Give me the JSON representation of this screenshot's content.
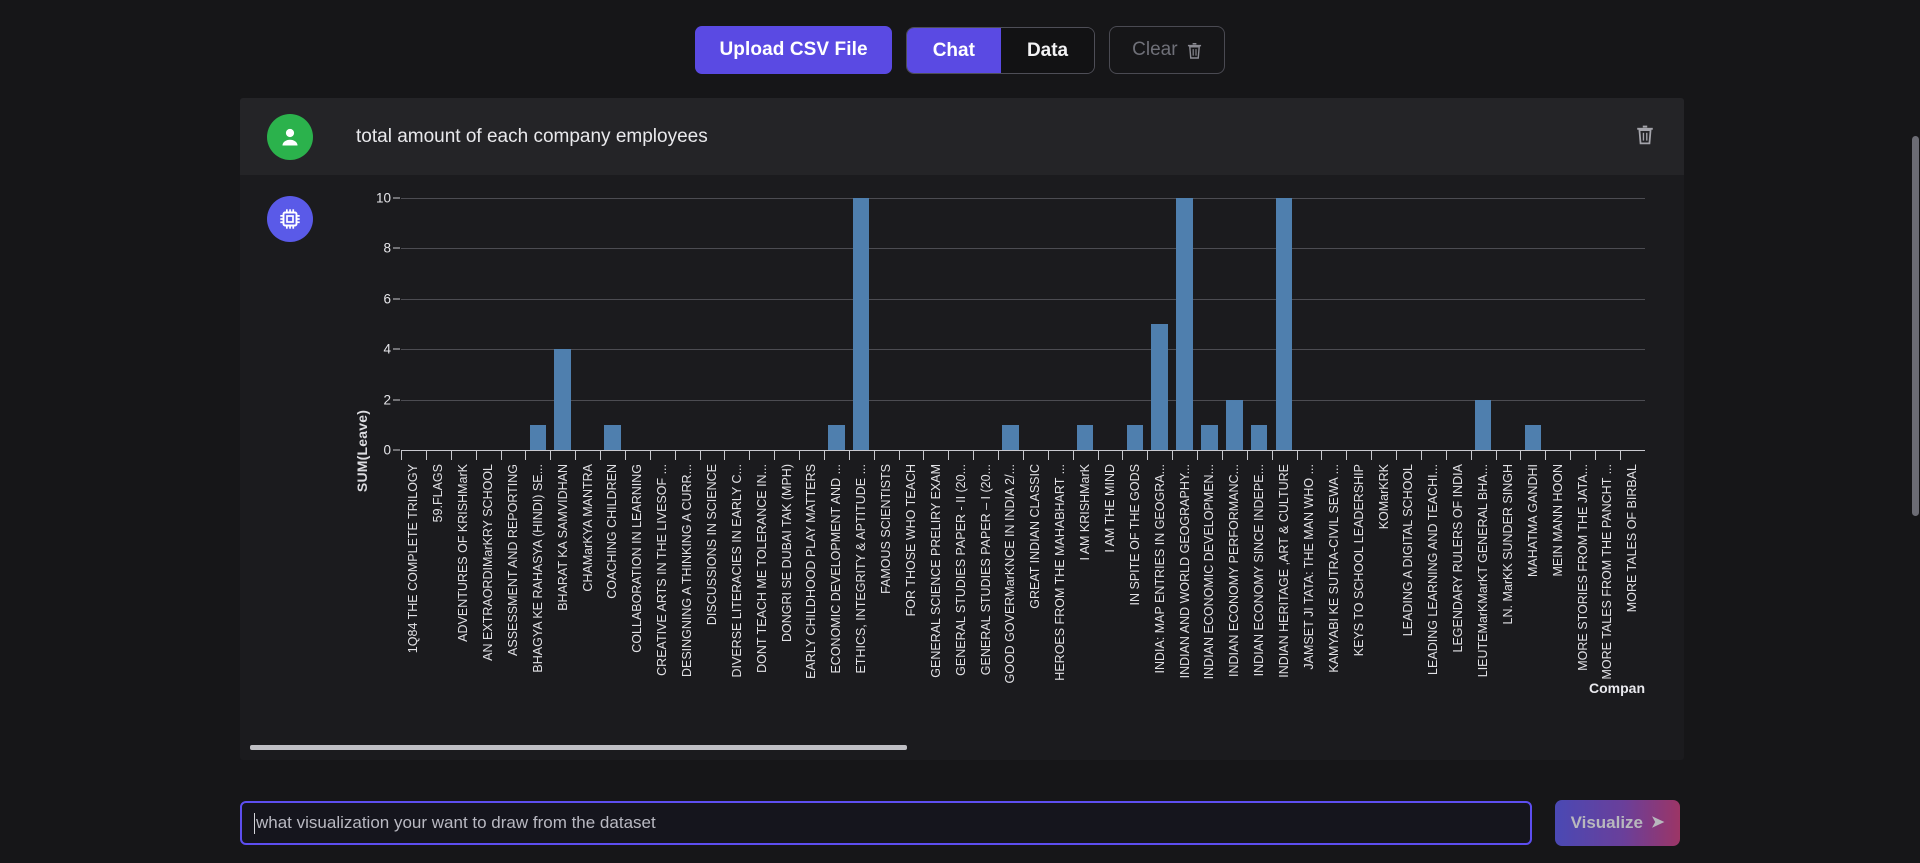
{
  "toolbar": {
    "upload_label": "Upload CSV File",
    "chat_label": "Chat",
    "data_label": "Data",
    "clear_label": "Clear",
    "trash_icon": "trash-icon",
    "accent": "#5a4ae3"
  },
  "conversation": {
    "user_message": "total amount of each company employees",
    "user_avatar_icon": "person-icon",
    "bot_avatar_icon": "cpu-chip-icon",
    "delete_icon": "trash-icon"
  },
  "input": {
    "placeholder": "what visualization your want to draw from the dataset",
    "value": "",
    "submit_label": "Visualize",
    "submit_icon": "send-arrow-icon"
  },
  "chart_data": {
    "type": "bar",
    "title": "",
    "xlabel": "Company",
    "ylabel": "SUM(Leave)",
    "ylim": [
      0,
      10
    ],
    "yticks": [
      0,
      2,
      4,
      6,
      8,
      10
    ],
    "grid": true,
    "bar_color": "#4f7fae",
    "legend": "none",
    "categories": [
      "1Q84 THE COMPLETE TRILOGY",
      "59.FLAGS",
      "ADVENTURES OF KRISHMarK",
      "AN EXTRAORDIMarKRY SCHOOL",
      "ASSESSMENT AND REPORTING",
      "BHAGYA KE RAHASYA (HINDI) SE...",
      "BHARAT KA SAMVIDHAN",
      "CHAMarKYA MANTRA",
      "COACHING CHILDREN",
      "COLLABORATION IN LEARNING",
      "CREATIVE ARTS IN THE LIVESOF ...",
      "DESINGNING A THINKING A CURR...",
      "DISCUSSIONS IN SCIENCE",
      "DIVERSE LITERACIES IN EARLY C...",
      "DONT TEACH ME TOLERANCE IN...",
      "DONGRI SE DUBAI TAK (MPH)",
      "EARLY CHILDHOOD PLAY MATTERS",
      "ECONOMIC DEVELOPMENT AND ...",
      "ETHICS, INTEGRITY & APTITUDE ...",
      "FAMOUS SCIENTISTS",
      "FOR THOSE WHO TEACH",
      "GENERAL SCIENCE PRELIRY EXAM",
      "GENERAL STUDIES PAPER - II (20...",
      "GENERAL STUDIES PAPER – I (20...",
      "GOOD GOVERMarKNCE IN INDIA 2/...",
      "GREAT INDIAN CLASSIC",
      "HEROES FROM THE MAHABHART ...",
      "I AM KRISHMarK",
      "I AM THE MIND",
      "IN SPITE OF THE GODS",
      "INDIA: MAP ENTRIES IN GEOGRA...",
      "INDIAN AND WORLD GEOGRAPHY...",
      "INDIAN ECONOMIC DEVELOPMEN...",
      "INDIAN ECONOMY PERFORMANC...",
      "INDIAN ECONOMY SINCE INDEPE...",
      "INDIAN HERITAGE ,ART & CULTURE",
      "JAMSET  JI TATA: THE MAN WHO ...",
      "KAMYABI KE SUTRA-CIVIL SEWA ...",
      "KEYS TO SCHOOL LEADERSHIP",
      "KOMarKRK",
      "LEADING A DIGITAL SCHOOL",
      "LEADING LEARNING AND TEACHI...",
      "LEGENDARY RULERS OF INDIA",
      "LIEUTEMarKMarKT  GENERAL BHA...",
      "LN. MarKK SUNDER SINGH",
      "MAHATMA GANDHI",
      "MEIN MANN HOON",
      "MORE STORIES FROM THE JATA...",
      "MORE TALES FROM THE PANCHT ...",
      "MORE TALES OF BIRBAL"
    ],
    "values": [
      0,
      0,
      0,
      0,
      0,
      1,
      4,
      0,
      1,
      0,
      0,
      0,
      0,
      0,
      0,
      0,
      0,
      1,
      10,
      0,
      0,
      0,
      0,
      0,
      1,
      0,
      0,
      1,
      0,
      1,
      5,
      10,
      1,
      2,
      1,
      10,
      0,
      0,
      0,
      0,
      0,
      0,
      0,
      2,
      0,
      1,
      0,
      0,
      0,
      0
    ]
  }
}
